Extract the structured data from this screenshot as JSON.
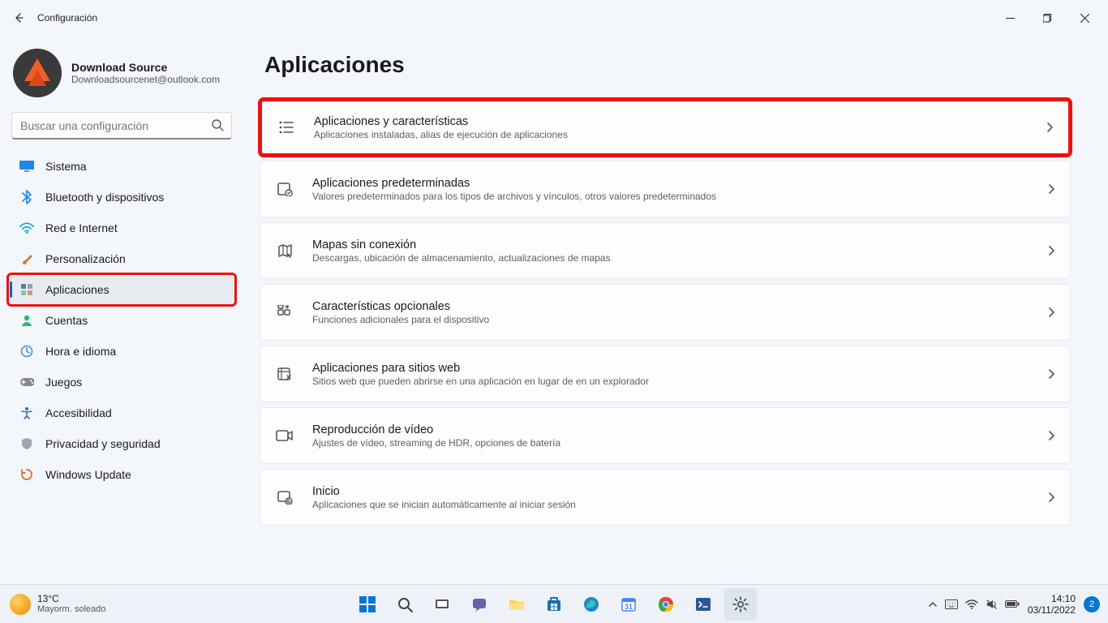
{
  "window": {
    "title": "Configuración"
  },
  "profile": {
    "name": "Download Source",
    "email": "Downloadsourcenet@outlook.com"
  },
  "search": {
    "placeholder": "Buscar una configuración"
  },
  "sidebar": {
    "items": [
      {
        "icon": "display-icon",
        "label": "Sistema",
        "color": "#1e88e5"
      },
      {
        "icon": "bluetooth-icon",
        "label": "Bluetooth y dispositivos",
        "color": "#1e88e5"
      },
      {
        "icon": "wifi-icon",
        "label": "Red e Internet",
        "color": "#00a3e0"
      },
      {
        "icon": "brush-icon",
        "label": "Personalización",
        "color": "#d17a3a"
      },
      {
        "icon": "apps-icon",
        "label": "Aplicaciones",
        "color": "#5a7ea8",
        "selected": true,
        "highlight": true
      },
      {
        "icon": "person-icon",
        "label": "Cuentas",
        "color": "#2bb673"
      },
      {
        "icon": "clock-icon",
        "label": "Hora e idioma",
        "color": "#4a90d9"
      },
      {
        "icon": "gamepad-icon",
        "label": "Juegos",
        "color": "#888"
      },
      {
        "icon": "accessibility-icon",
        "label": "Accesibilidad",
        "color": "#3a6ea5"
      },
      {
        "icon": "shield-icon",
        "label": "Privacidad y seguridad",
        "color": "#9aa7b2"
      },
      {
        "icon": "update-icon",
        "label": "Windows Update",
        "color": "#e26a2c"
      }
    ]
  },
  "page": {
    "title": "Aplicaciones"
  },
  "cards": [
    {
      "icon": "list-icon",
      "title": "Aplicaciones y características",
      "desc": "Aplicaciones instaladas, alias de ejecución de aplicaciones",
      "highlight": true
    },
    {
      "icon": "defaults-icon",
      "title": "Aplicaciones predeterminadas",
      "desc": "Valores predeterminados para los tipos de archivos y vínculos, otros valores predeterminados"
    },
    {
      "icon": "map-icon",
      "title": "Mapas sin conexión",
      "desc": "Descargas, ubicación de almacenamiento, actualizaciones de mapas"
    },
    {
      "icon": "features-icon",
      "title": "Características opcionales",
      "desc": "Funciones adicionales para el dispositivo"
    },
    {
      "icon": "websites-icon",
      "title": "Aplicaciones para sitios web",
      "desc": "Sitios web que pueden abrirse en una aplicación en lugar de en un explorador"
    },
    {
      "icon": "video-icon",
      "title": "Reproducción de vídeo",
      "desc": "Ajustes de vídeo, streaming de HDR, opciones de batería"
    },
    {
      "icon": "startup-icon",
      "title": "Inicio",
      "desc": "Aplicaciones que se inician automáticamente al iniciar sesión"
    }
  ],
  "taskbar": {
    "weather_temp": "13°C",
    "weather_desc": "Mayorm. soleado",
    "time": "14:10",
    "date": "03/11/2022",
    "notif_count": "2"
  }
}
